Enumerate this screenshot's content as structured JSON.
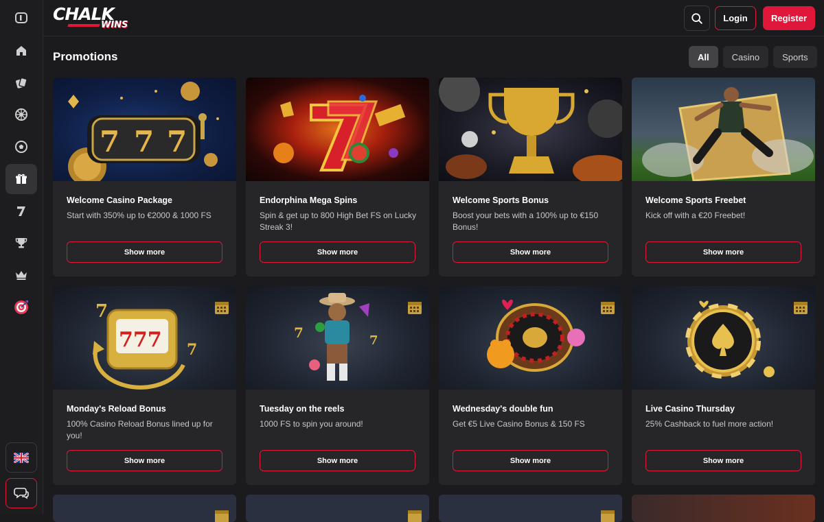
{
  "brand": {
    "name_top": "CHALK",
    "name_bottom": "WINS",
    "accent": "#e0173b"
  },
  "header": {
    "login_label": "Login",
    "register_label": "Register"
  },
  "page": {
    "title": "Promotions"
  },
  "filters": [
    {
      "label": "All"
    },
    {
      "label": "Casino"
    },
    {
      "label": "Sports"
    }
  ],
  "sidebar": {
    "items": [
      {
        "icon": "sidebar-toggle-icon"
      },
      {
        "icon": "home-icon"
      },
      {
        "icon": "casino-chips-icon"
      },
      {
        "icon": "roulette-icon"
      },
      {
        "icon": "soccer-ball-icon"
      },
      {
        "icon": "gift-icon"
      },
      {
        "icon": "seven-icon"
      },
      {
        "icon": "trophy-icon"
      },
      {
        "icon": "crown-icon"
      },
      {
        "icon": "target-icon"
      }
    ],
    "language_icon": "uk-flag-icon",
    "chat_icon": "chat-icon"
  },
  "promotions": [
    {
      "title": "Welcome Casino Package",
      "description": "Start with 350% up to €2000 & 1000 FS",
      "button": "Show more"
    },
    {
      "title": "Endorphina Mega Spins",
      "description": "Spin & get up to 800 High Bet FS on Lucky Streak 3!",
      "button": "Show more"
    },
    {
      "title": "Welcome Sports Bonus",
      "description": "Boost your bets with a 100% up to €150 Bonus!",
      "button": "Show more"
    },
    {
      "title": "Welcome Sports Freebet",
      "description": "Kick off with a €20 Freebet!",
      "button": "Show more"
    },
    {
      "title": "Monday's Reload Bonus",
      "description": "100% Casino Reload Bonus lined up for you!",
      "button": "Show more"
    },
    {
      "title": "Tuesday on the reels",
      "description": "1000 FS to spin you around!",
      "button": "Show more"
    },
    {
      "title": "Wednesday's double fun",
      "description": "Get €5 Live Casino Bonus & 150 FS",
      "button": "Show more"
    },
    {
      "title": "Live Casino Thursday",
      "description": "25% Cashback to fuel more action!",
      "button": "Show more"
    }
  ]
}
